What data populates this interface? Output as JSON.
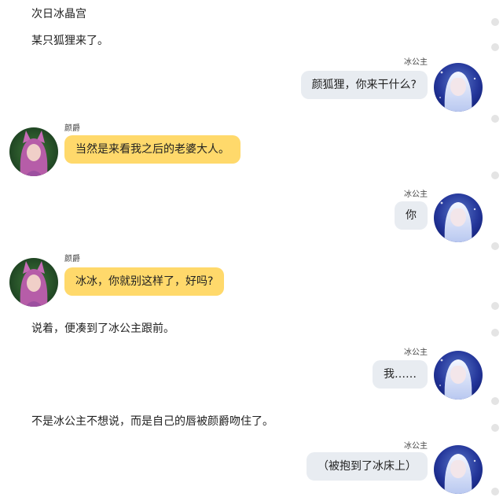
{
  "characters": {
    "bing": {
      "name": "冰公主",
      "avatar_icon": "bing-princess-avatar-icon"
    },
    "yan": {
      "name": "颜爵",
      "avatar_icon": "yan-jue-avatar-icon"
    }
  },
  "narration": [
    "次日冰晶宫",
    "某只狐狸来了。",
    "说着，便凑到了冰公主跟前。",
    "不是冰公主不想说，而是自己的唇被颜爵吻住了。"
  ],
  "messages": [
    {
      "speaker": "冰公主",
      "text": "颜狐狸，你来干什么?"
    },
    {
      "speaker": "颜爵",
      "text": "当然是来看我之后的老婆大人。"
    },
    {
      "speaker": "冰公主",
      "text": "你"
    },
    {
      "speaker": "颜爵",
      "text": "冰冰，你就别这样了，好吗?"
    },
    {
      "speaker": "冰公主",
      "text": "我……"
    },
    {
      "speaker": "冰公主",
      "text": "（被抱到了冰床上）"
    }
  ],
  "colors": {
    "right_bubble": "#e8ecf1",
    "left_bubble": "#ffd96b",
    "side_dot": "#e4e4e4"
  }
}
